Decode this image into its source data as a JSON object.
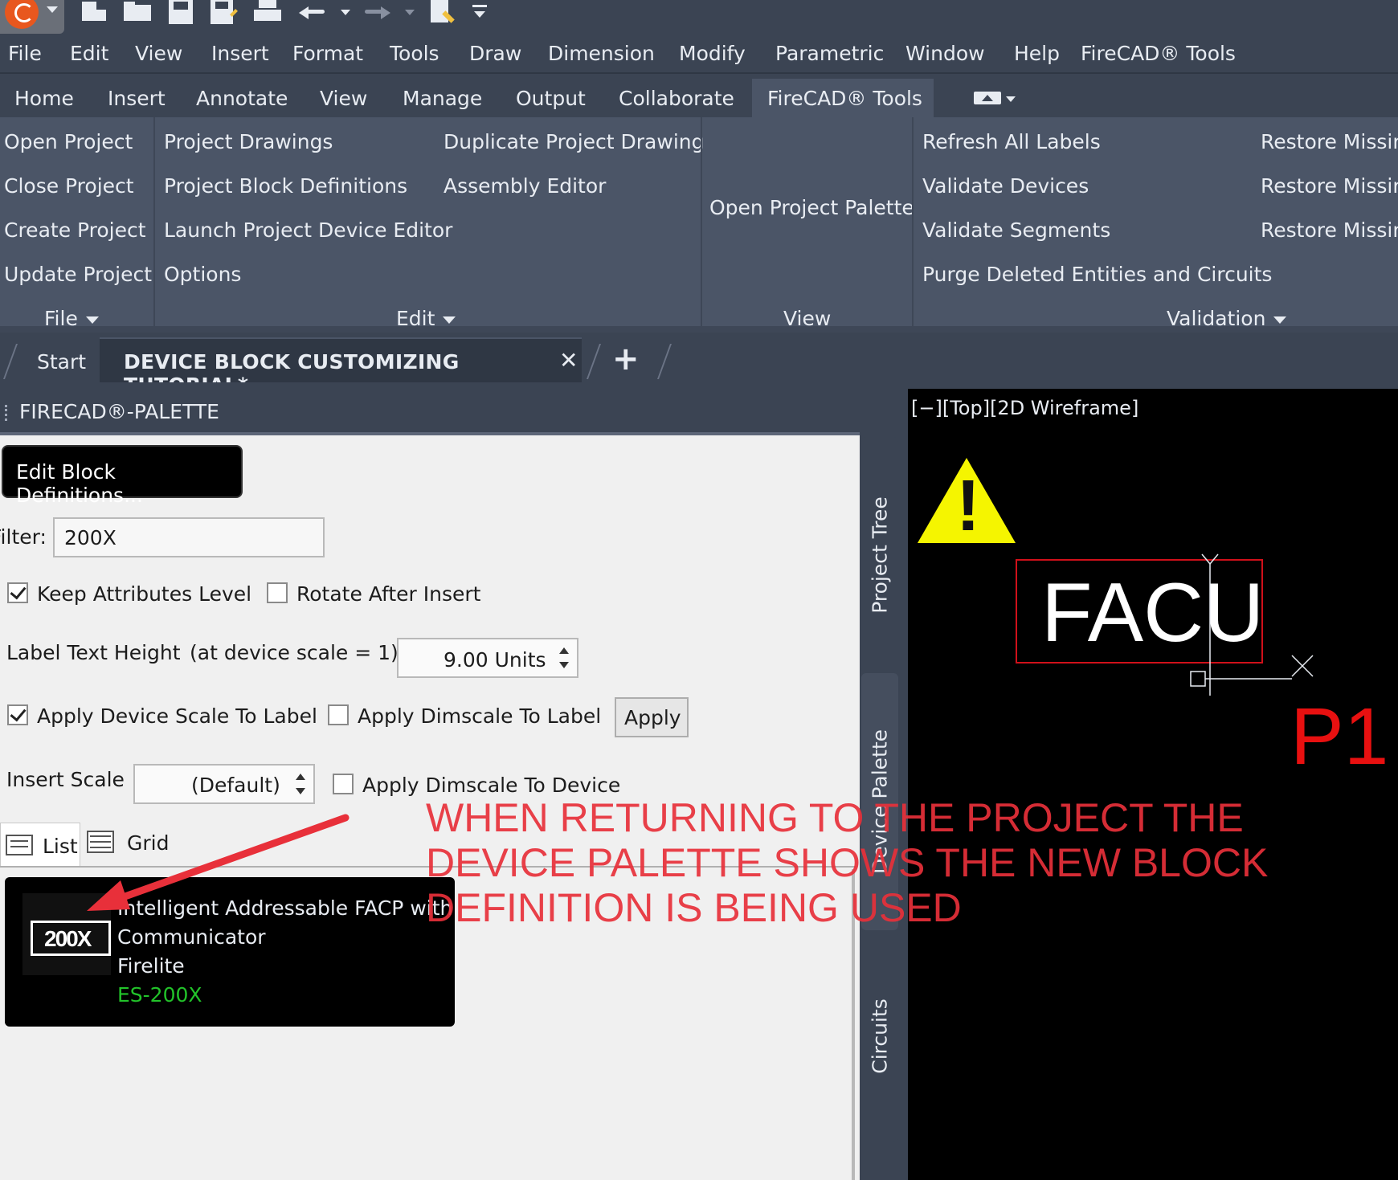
{
  "menu": [
    "File",
    "Edit",
    "View",
    "Insert",
    "Format",
    "Tools",
    "Draw",
    "Dimension",
    "Modify",
    "Parametric",
    "Window",
    "Help",
    "FireCAD® Tools"
  ],
  "ribbon_tabs": [
    "Home",
    "Insert",
    "Annotate",
    "View",
    "Manage",
    "Output",
    "Collaborate",
    "FireCAD® Tools"
  ],
  "ribbon": {
    "file": {
      "title": "File",
      "items": [
        "Open Project",
        "Close Project",
        "Create Project",
        "Update Project"
      ]
    },
    "edit": {
      "title": "Edit",
      "col1": [
        "Project Drawings",
        "Project Block Definitions",
        "Launch Project Device Editor",
        "Options"
      ],
      "col2": [
        "Duplicate Project Drawing",
        "Assembly Editor"
      ]
    },
    "view": {
      "title": "View",
      "item": "Open Project Palette"
    },
    "validation": {
      "title": "Validation",
      "col1": [
        "Refresh All Labels",
        "Validate Devices",
        "Validate Segments",
        "Purge Deleted Entities and Circuits"
      ],
      "col2": [
        "Restore Missing",
        "Restore Missing",
        "Restore Missing"
      ]
    }
  },
  "filetabs": {
    "start": "Start",
    "active": "DEVICE BLOCK CUSTOMIZING TUTORIAL*",
    "close": "✕",
    "add": "+"
  },
  "palette": {
    "title": "FIRECAD®-PALETTE",
    "edit_button": "Edit Block Definitions...",
    "filter_label": "Filter:",
    "filter_value": "200X",
    "keep_attributes": "Keep Attributes Level",
    "keep_attributes_checked": true,
    "rotate_after_insert": "Rotate After Insert",
    "rotate_after_insert_checked": false,
    "label_text_height": "Label Text Height",
    "device_scale_note": "(at device scale = 1)",
    "label_height_value": "9.00 Units",
    "apply_device_scale": "Apply Device Scale To Label",
    "apply_device_scale_checked": true,
    "apply_dimscale_label": "Apply Dimscale To Label",
    "apply_dimscale_label_checked": false,
    "apply_button": "Apply",
    "insert_scale": "Insert Scale",
    "insert_scale_value": "(Default)",
    "apply_dimscale_device": "Apply Dimscale To Device",
    "apply_dimscale_device_checked": false,
    "view_list": "List",
    "view_grid": "Grid",
    "device": {
      "icon_text": "200X",
      "line1": "Intelligent Addressable FACP with",
      "line2": "Communicator",
      "manufacturer": "Firelite",
      "part": "ES-200X"
    }
  },
  "side_tabs": [
    "Project Tree",
    "Device Palette",
    "Circuits"
  ],
  "viewport": {
    "label": "[−][Top][2D Wireframe]",
    "block_text": "FACU",
    "tag": "P1",
    "warning": "!"
  },
  "annotation": [
    "WHEN RETURNING TO THE PROJECT THE",
    "DEVICE PALETTE SHOWS THE NEW BLOCK",
    "DEFINITION IS BEING USED"
  ],
  "colors": {
    "ribbon_bg": "#4b5567",
    "bar_bg": "#3b4453",
    "annotation": "#e8303a",
    "part_number": "#22c32a",
    "facu_border": "#d0101a"
  }
}
